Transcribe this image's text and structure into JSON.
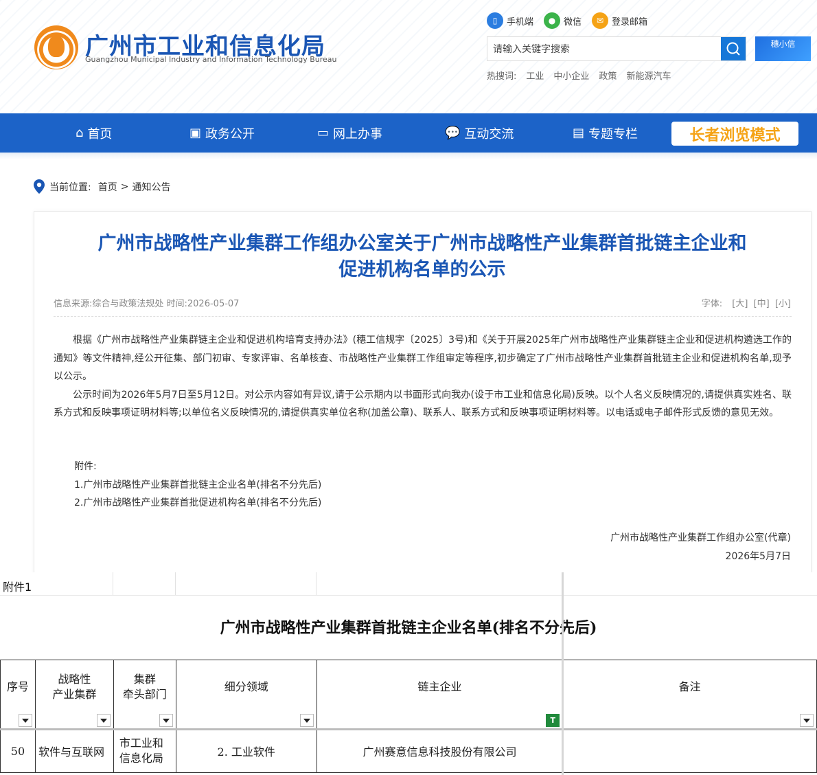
{
  "header": {
    "site_title": "广州市工业和信息化局",
    "site_subtitle": "Guangzhou Municipal Industry and Information Technology Bureau",
    "quick_links": [
      {
        "label": "手机端",
        "icon": "mobile-icon",
        "color": "#2b7de0"
      },
      {
        "label": "微信",
        "icon": "wechat-icon",
        "color": "#3bb34a"
      },
      {
        "label": "登录邮箱",
        "icon": "mail-icon",
        "color": "#f5a316"
      }
    ],
    "search_placeholder": "请输入关键字搜索",
    "badge_text": "穗小信",
    "hot_label": "热搜词:",
    "hot_words": [
      "工业",
      "中小企业",
      "政策",
      "新能源汽车"
    ]
  },
  "nav": {
    "items": [
      {
        "label": "首页",
        "icon": "home-icon"
      },
      {
        "label": "政务公开",
        "icon": "briefcase-icon"
      },
      {
        "label": "网上办事",
        "icon": "monitor-icon"
      },
      {
        "label": "互动交流",
        "icon": "chat-icon"
      },
      {
        "label": "专题专栏",
        "icon": "column-icon"
      }
    ],
    "elder_mode": "长者浏览模式",
    "color": "#1c63c8"
  },
  "breadcrumb": {
    "label": "当前位置:",
    "home": "首页",
    "sep": ">",
    "current": "通知公告"
  },
  "article": {
    "title_line1": "广州市战略性产业集群工作组办公室关于广州市战略性产业集群首批链主企业和",
    "title_line2": "促进机构名单的公示",
    "meta": "信息来源:综合与政策法规处 时间:2026-05-07",
    "font_label": "字体:",
    "font_sizes": [
      "[大]",
      "[中]",
      "[小]"
    ],
    "paragraphs": [
      "根据《广州市战略性产业集群链主企业和促进机构培育支持办法》(穗工信规字〔2025〕3号)和《关于开展2025年广州市战略性产业集群链主企业和促进机构遴选工作的通知》等文件精神,经公开征集、部门初审、专家评审、名单核查、市战略性产业集群工作组审定等程序,初步确定了广州市战略性产业集群首批链主企业和促进机构名单,现予以公示。",
      "公示时间为2026年5月7日至5月12日。对公示内容如有异议,请于公示期内以书面形式向我办(设于市工业和信息化局)反映。以个人名义反映情况的,请提供真实姓名、联系方式和反映事项证明材料等;以单位名义反映情况的,请提供真实单位名称(加盖公章)、联系人、联系方式和反映事项证明材料等。以电话或电子邮件形式反馈的意见无效。"
    ],
    "attachments_label": "附件:",
    "attachments": [
      "1.广州市战略性产业集群首批链主企业名单(排名不分先后)",
      "2.广州市战略性产业集群首批促进机构名单(排名不分先后)"
    ],
    "signature": "广州市战略性产业集群工作组办公室(代章)",
    "date": "2026年5月7日"
  },
  "sheet": {
    "label": "附件1",
    "title": "广州市战略性产业集群首批链主企业名单(排名不分先后)",
    "headers": [
      [
        "序号"
      ],
      [
        "战略性",
        "产业集群"
      ],
      [
        "集群",
        "牵头部门"
      ],
      [
        "细分领域"
      ],
      [
        "链主企业"
      ],
      [
        "备注"
      ]
    ],
    "rows": [
      {
        "no": "50",
        "cluster": "软件与互联网",
        "dept_line1": "市工业和",
        "dept_line2": "信息化局",
        "field": "2. 工业软件",
        "company": "广州赛意信息科技股份有限公司",
        "note": ""
      }
    ]
  }
}
